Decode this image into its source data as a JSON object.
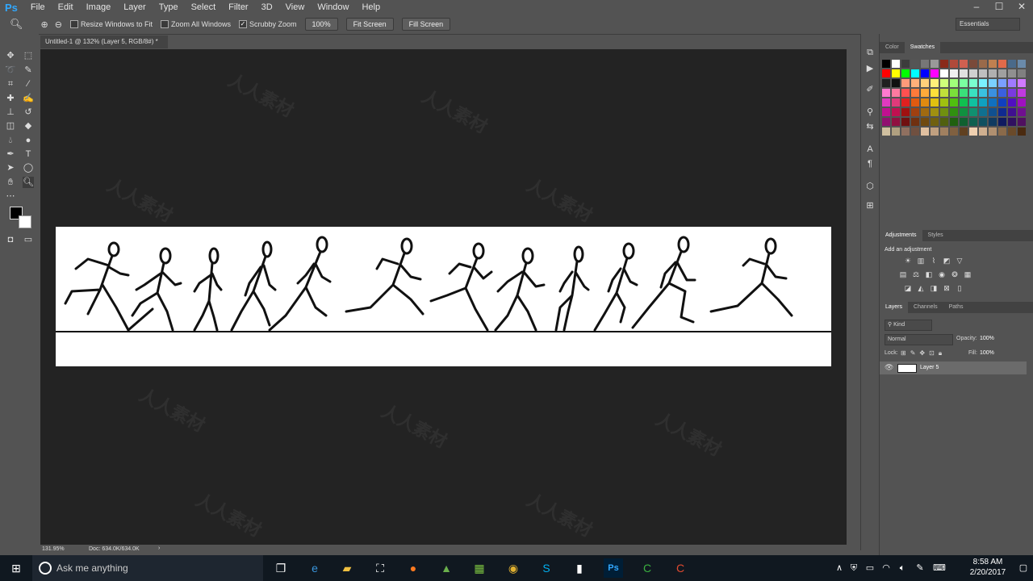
{
  "app": {
    "logo": "Ps",
    "menu": [
      "File",
      "Edit",
      "Image",
      "Layer",
      "Type",
      "Select",
      "Filter",
      "3D",
      "View",
      "Window",
      "Help"
    ],
    "window_controls": [
      "–",
      "☐",
      "✕"
    ]
  },
  "options": {
    "resize_windows": "Resize Windows to Fit",
    "zoom_all": "Zoom All Windows",
    "scrubby_zoom": "Scrubby Zoom",
    "zoom_value": "100%",
    "fit_screen": "Fit Screen",
    "fill_screen": "Fill Screen",
    "workspace": "Essentials"
  },
  "document": {
    "tab_title": "Untitled-1 @ 132% (Layer 5, RGB/8#) *",
    "zoom_status": "131.95%",
    "doc_size": "Doc: 634.0K/634.0K"
  },
  "panels": {
    "color_tab": "Color",
    "swatches_tab": "Swatches",
    "adjustments_tab": "Adjustments",
    "styles_tab": "Styles",
    "add_adjustment": "Add an adjustment",
    "layers_tab": "Layers",
    "channels_tab": "Channels",
    "paths_tab": "Paths",
    "kind_filter": "Kind",
    "blend_mode": "Normal",
    "opacity_label": "Opacity:",
    "opacity_value": "100%",
    "lock_label": "Lock:",
    "fill_label": "Fill:",
    "fill_value": "100%",
    "layer_name": "Layer 5"
  },
  "swatch_colors": [
    [
      "#000000",
      "#ffffff",
      "#3c3c3c",
      "#555555",
      "#777777",
      "#999999",
      "#8a2a1a",
      "#b04a3a",
      "#d06050",
      "#7a4a3a",
      "#9a6a4a",
      "#c08050",
      "#e06a4a",
      "#4a6a8a",
      "#6a8aaa"
    ],
    [
      "#ff0000",
      "#ffff00",
      "#00ff00",
      "#00ffff",
      "#0000ff",
      "#ff00ff",
      "#ffffff",
      "#f0f0f0",
      "#e0e0e0",
      "#d0d0d0",
      "#c0c0c0",
      "#b0b0b0",
      "#a0a0a0",
      "#909090",
      "#808080"
    ],
    [
      "#202020",
      "#101010",
      "#ff9a7a",
      "#ffb07a",
      "#ffd07a",
      "#fff07a",
      "#d0ff7a",
      "#a0ff7a",
      "#7affa0",
      "#7affd0",
      "#7af0ff",
      "#7ad0ff",
      "#7aa0ff",
      "#a07aff",
      "#d07aff"
    ],
    [
      "#ff7ad0",
      "#ff7aa0",
      "#ff5050",
      "#ff7a3a",
      "#ffaa3a",
      "#ffe03a",
      "#c0e03a",
      "#7ae03a",
      "#3ae07a",
      "#3ae0c0",
      "#3ac0e0",
      "#3a90e0",
      "#3a60e0",
      "#7a3ae0",
      "#c03ae0"
    ],
    [
      "#e03ac0",
      "#e03a7a",
      "#e02020",
      "#e05a10",
      "#e08a10",
      "#e0c010",
      "#a0c010",
      "#50c010",
      "#10c050",
      "#10c0a0",
      "#10a0c0",
      "#1070c0",
      "#1040c0",
      "#5010c0",
      "#a010c0"
    ],
    [
      "#c01090",
      "#c01050",
      "#a01010",
      "#a04010",
      "#a06a10",
      "#a09010",
      "#709010",
      "#309010",
      "#109040",
      "#109070",
      "#107090",
      "#105090",
      "#102a90",
      "#401090",
      "#701090"
    ],
    [
      "#901070",
      "#901040",
      "#701010",
      "#703010",
      "#704a10",
      "#706010",
      "#506010",
      "#206010",
      "#106030",
      "#106050",
      "#105060",
      "#103a60",
      "#101a60",
      "#301060",
      "#501060"
    ],
    [
      "#d0c0a0",
      "#b0a080",
      "#907060",
      "#705040",
      "#e0c0a0",
      "#c0a080",
      "#a08060",
      "#806040",
      "#604020",
      "#f0d0b0",
      "#d0b090",
      "#b09070",
      "#8a6a4a",
      "#6a4a2a",
      "#4a2a10"
    ]
  ],
  "taskbar": {
    "search_placeholder": "Ask me anything",
    "time": "8:58 AM",
    "date": "2/20/2017"
  },
  "watermark": "人人素材"
}
